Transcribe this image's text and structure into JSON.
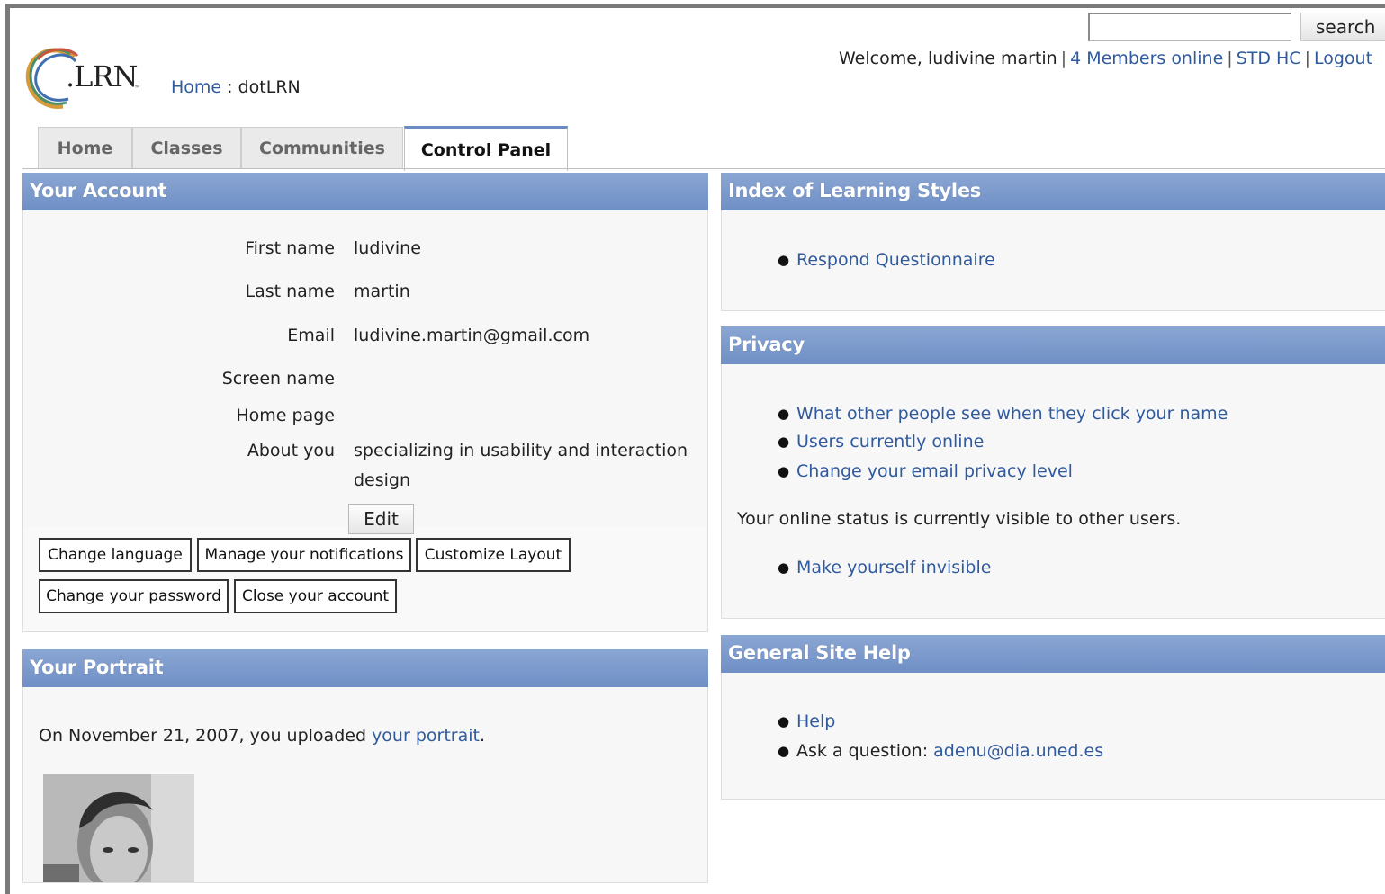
{
  "header": {
    "search_button": "search",
    "search_value": "",
    "welcome_text": "Welcome, ludivine martin",
    "members_online": "4 Members online",
    "community_link": "STD HC",
    "logout": "Logout",
    "logo_text": ".LRN",
    "logo_tm": "™"
  },
  "breadcrumb": {
    "home": "Home",
    "separator": ":",
    "current": "dotLRN"
  },
  "tabs": [
    {
      "label": "Home",
      "active": false
    },
    {
      "label": "Classes",
      "active": false
    },
    {
      "label": "Communities",
      "active": false
    },
    {
      "label": "Control Panel",
      "active": true
    }
  ],
  "account": {
    "title": "Your Account",
    "fields": [
      {
        "label": "First name",
        "value": "ludivine"
      },
      {
        "label": "Last name",
        "value": "martin"
      },
      {
        "label": "Email",
        "value": "ludivine.martin@gmail.com"
      },
      {
        "label": "Screen name",
        "value": ""
      },
      {
        "label": "Home page",
        "value": ""
      },
      {
        "label": "About you",
        "value": "specializing in usability and interaction",
        "value2": "design"
      }
    ],
    "edit_button": "Edit",
    "buttons": [
      "Change language",
      "Manage your notifications",
      "Customize Layout",
      "Change your password",
      "Close your account"
    ]
  },
  "portrait": {
    "title": "Your Portrait",
    "text_before": "On November 21, 2007, you uploaded",
    "link": "your portrait",
    "text_after": "."
  },
  "learning_styles": {
    "title": "Index of Learning Styles",
    "links": [
      "Respond Questionnaire"
    ]
  },
  "privacy": {
    "title": "Privacy",
    "links": [
      "What other people see when they click your name",
      "Users currently online",
      "Change your email privacy level"
    ],
    "status_text": "Your online status is currently visible to other users.",
    "status_link": "Make yourself invisible"
  },
  "help": {
    "title": "General Site Help",
    "help_link": "Help",
    "ask_label": "Ask a question:",
    "ask_email": "adenu@dia.uned.es"
  },
  "colors": {
    "header_bar": "#7b99cc",
    "link": "#2f5a9e",
    "tab_active_border": "#6a8cc4"
  }
}
